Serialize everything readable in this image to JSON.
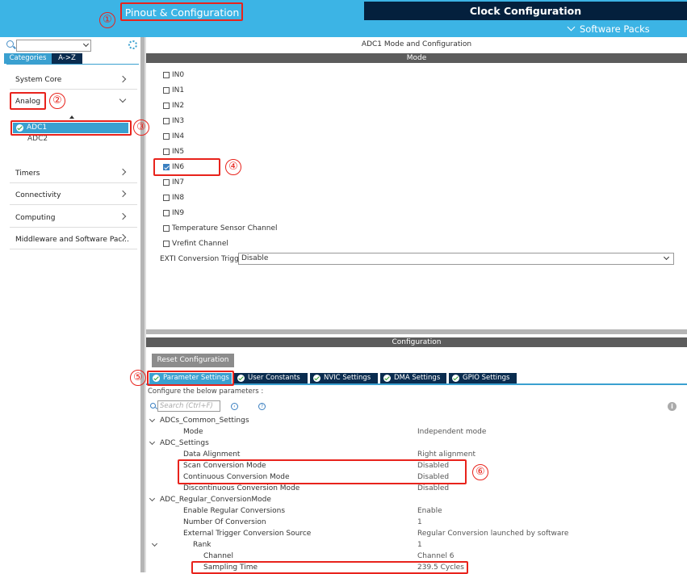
{
  "header": {
    "tab_pinout": "Pinout & Configuration",
    "tab_clock": "Clock Configuration",
    "software_packs": "Software Packs"
  },
  "sidebar": {
    "search_value": "",
    "tab_categories": "Categories",
    "tab_az": "A->Z",
    "items": [
      {
        "label": "System Core"
      },
      {
        "label": "Analog"
      },
      {
        "label": "Timers"
      },
      {
        "label": "Connectivity"
      },
      {
        "label": "Computing"
      },
      {
        "label": "Middleware and Software Pac..."
      }
    ],
    "analog_children": [
      "ADC1",
      "ADC2"
    ]
  },
  "main": {
    "title": "ADC1 Mode and Configuration",
    "mode_header": "Mode",
    "channels": [
      {
        "label": "IN0",
        "checked": false
      },
      {
        "label": "IN1",
        "checked": false
      },
      {
        "label": "IN2",
        "checked": false
      },
      {
        "label": "IN3",
        "checked": false
      },
      {
        "label": "IN4",
        "checked": false
      },
      {
        "label": "IN5",
        "checked": false
      },
      {
        "label": "IN6",
        "checked": true
      },
      {
        "label": "IN7",
        "checked": false
      },
      {
        "label": "IN8",
        "checked": false
      },
      {
        "label": "IN9",
        "checked": false
      },
      {
        "label": "Temperature Sensor Channel",
        "checked": false
      },
      {
        "label": "Vrefint Channel",
        "checked": false
      }
    ],
    "exti_label": "EXTI Conversion Trigger",
    "exti_value": "Disable",
    "config_header": "Configuration",
    "reset_button": "Reset Configuration",
    "tabs": [
      "Parameter Settings",
      "User Constants",
      "NVIC Settings",
      "DMA Settings",
      "GPIO Settings"
    ],
    "configure_text": "Configure the below parameters :",
    "search_placeholder": "Search (Ctrl+F)",
    "params": [
      {
        "key": "ADCs_Common_Settings",
        "value": ""
      },
      {
        "key": "Mode",
        "value": "Independent mode"
      },
      {
        "key": "ADC_Settings",
        "value": ""
      },
      {
        "key": "Data Alignment",
        "value": "Right alignment"
      },
      {
        "key": "Scan Conversion Mode",
        "value": "Disabled"
      },
      {
        "key": "Continuous Conversion Mode",
        "value": "Disabled"
      },
      {
        "key": "Discontinuous Conversion Mode",
        "value": "Disabled"
      },
      {
        "key": "ADC_Regular_ConversionMode",
        "value": ""
      },
      {
        "key": "Enable Regular Conversions",
        "value": "Enable"
      },
      {
        "key": "Number Of Conversion",
        "value": "1"
      },
      {
        "key": "External Trigger Conversion Source",
        "value": "Regular Conversion launched by software"
      },
      {
        "key": "Rank",
        "value": "1"
      },
      {
        "key": "Channel",
        "value": "Channel 6"
      },
      {
        "key": "Sampling Time",
        "value": "239.5 Cycles"
      }
    ]
  },
  "annotations": [
    "①",
    "②",
    "③",
    "④",
    "⑤",
    "⑥"
  ],
  "colors": {
    "accent": "#3aa0d0",
    "dark_tab": "#0a2c4f",
    "highlight_red": "#e8231c",
    "header_blue": "#3cb4e5"
  }
}
